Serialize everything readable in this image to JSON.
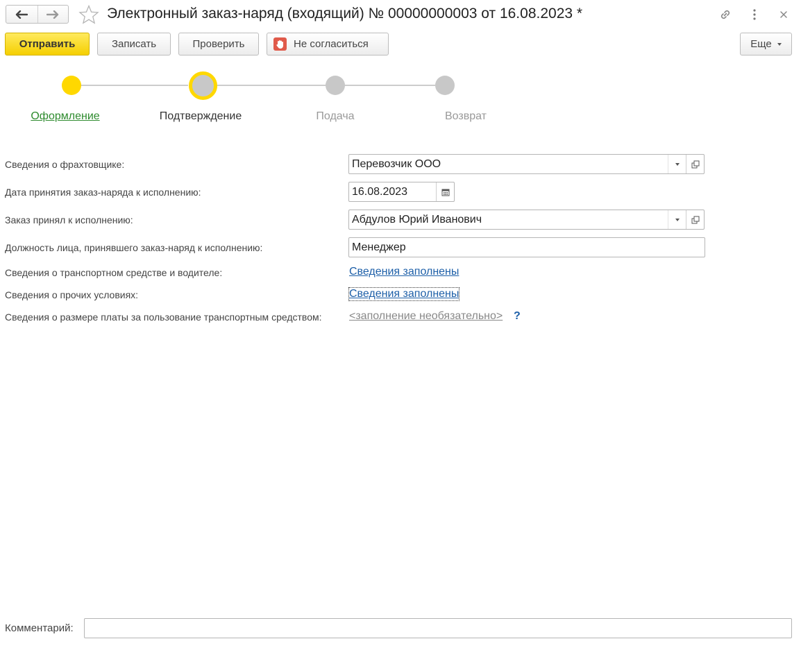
{
  "window": {
    "title": "Электронный заказ-наряд (входящий) № 00000000003 от 16.08.2023 *"
  },
  "toolbar": {
    "send_label": "Отправить",
    "save_label": "Записать",
    "check_label": "Проверить",
    "disagree_label": "Не согласиться",
    "more_label": "Еще"
  },
  "stepper": {
    "steps": [
      {
        "label": "Оформление",
        "state": "done"
      },
      {
        "label": "Подтверждение",
        "state": "current"
      },
      {
        "label": "Подача",
        "state": "pending"
      },
      {
        "label": "Возврат",
        "state": "pending"
      }
    ]
  },
  "form": {
    "charterer": {
      "label": "Сведения о фрахтовщике:",
      "value": "Перевозчик ООО"
    },
    "accept_date": {
      "label": "Дата принятия заказ-наряда к исполнению:",
      "value": "16.08.2023"
    },
    "accepted_by": {
      "label": "Заказ принял к исполнению:",
      "value": "Абдулов Юрий Иванович"
    },
    "position": {
      "label": "Должность лица, принявшего заказ-наряд к исполнению:",
      "value": "Менеджер"
    },
    "vehicle_driver": {
      "label": "Сведения о транспортном средстве и водителе:",
      "link": "Сведения заполнены"
    },
    "other_conditions": {
      "label": "Сведения о прочих условиях:",
      "link": "Сведения заполнены"
    },
    "fee": {
      "label": "Сведения о размере платы за пользование транспортным средством:",
      "link": "<заполнение необязательно>",
      "help": "?"
    },
    "comment": {
      "label": "Комментарий:",
      "value": ""
    }
  },
  "colors": {
    "accent_yellow": "#ffd800",
    "link_blue": "#1d5fa8",
    "done_green": "#2e8b2e",
    "pending_gray": "#c8c8c8"
  }
}
